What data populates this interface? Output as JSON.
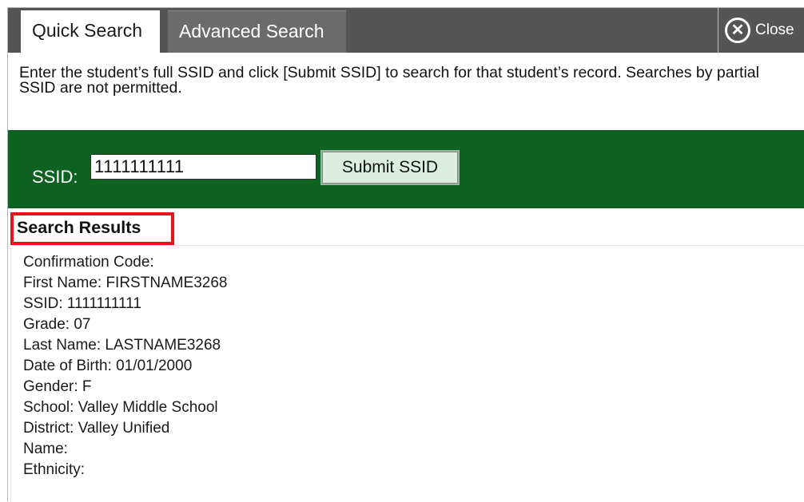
{
  "tabs": {
    "quick": "Quick Search",
    "advanced": "Advanced Search"
  },
  "close": {
    "label": "Close",
    "icon": "close-icon"
  },
  "instructions": "Enter the student’s full SSID and click [Submit SSID] to search for that student’s record. Searches by partial SSID are not permitted.",
  "ssid": {
    "label": "SSID:",
    "value": "1111111111",
    "submit_label": "Submit SSID"
  },
  "results": {
    "title": "Search Results",
    "lines": [
      "Confirmation Code:",
      "First Name: FIRSTNAME3268",
      "SSID: 1111111111",
      "Grade: 07",
      "Last Name: LASTNAME3268",
      "Date of Birth: 01/01/2000",
      "Gender: F",
      "School: Valley Middle School",
      "District: Valley Unified",
      "Name:",
      "Ethnicity:"
    ]
  },
  "colors": {
    "tabbar": "#555555",
    "band": "#0d6121",
    "highlight": "#e8121e"
  }
}
